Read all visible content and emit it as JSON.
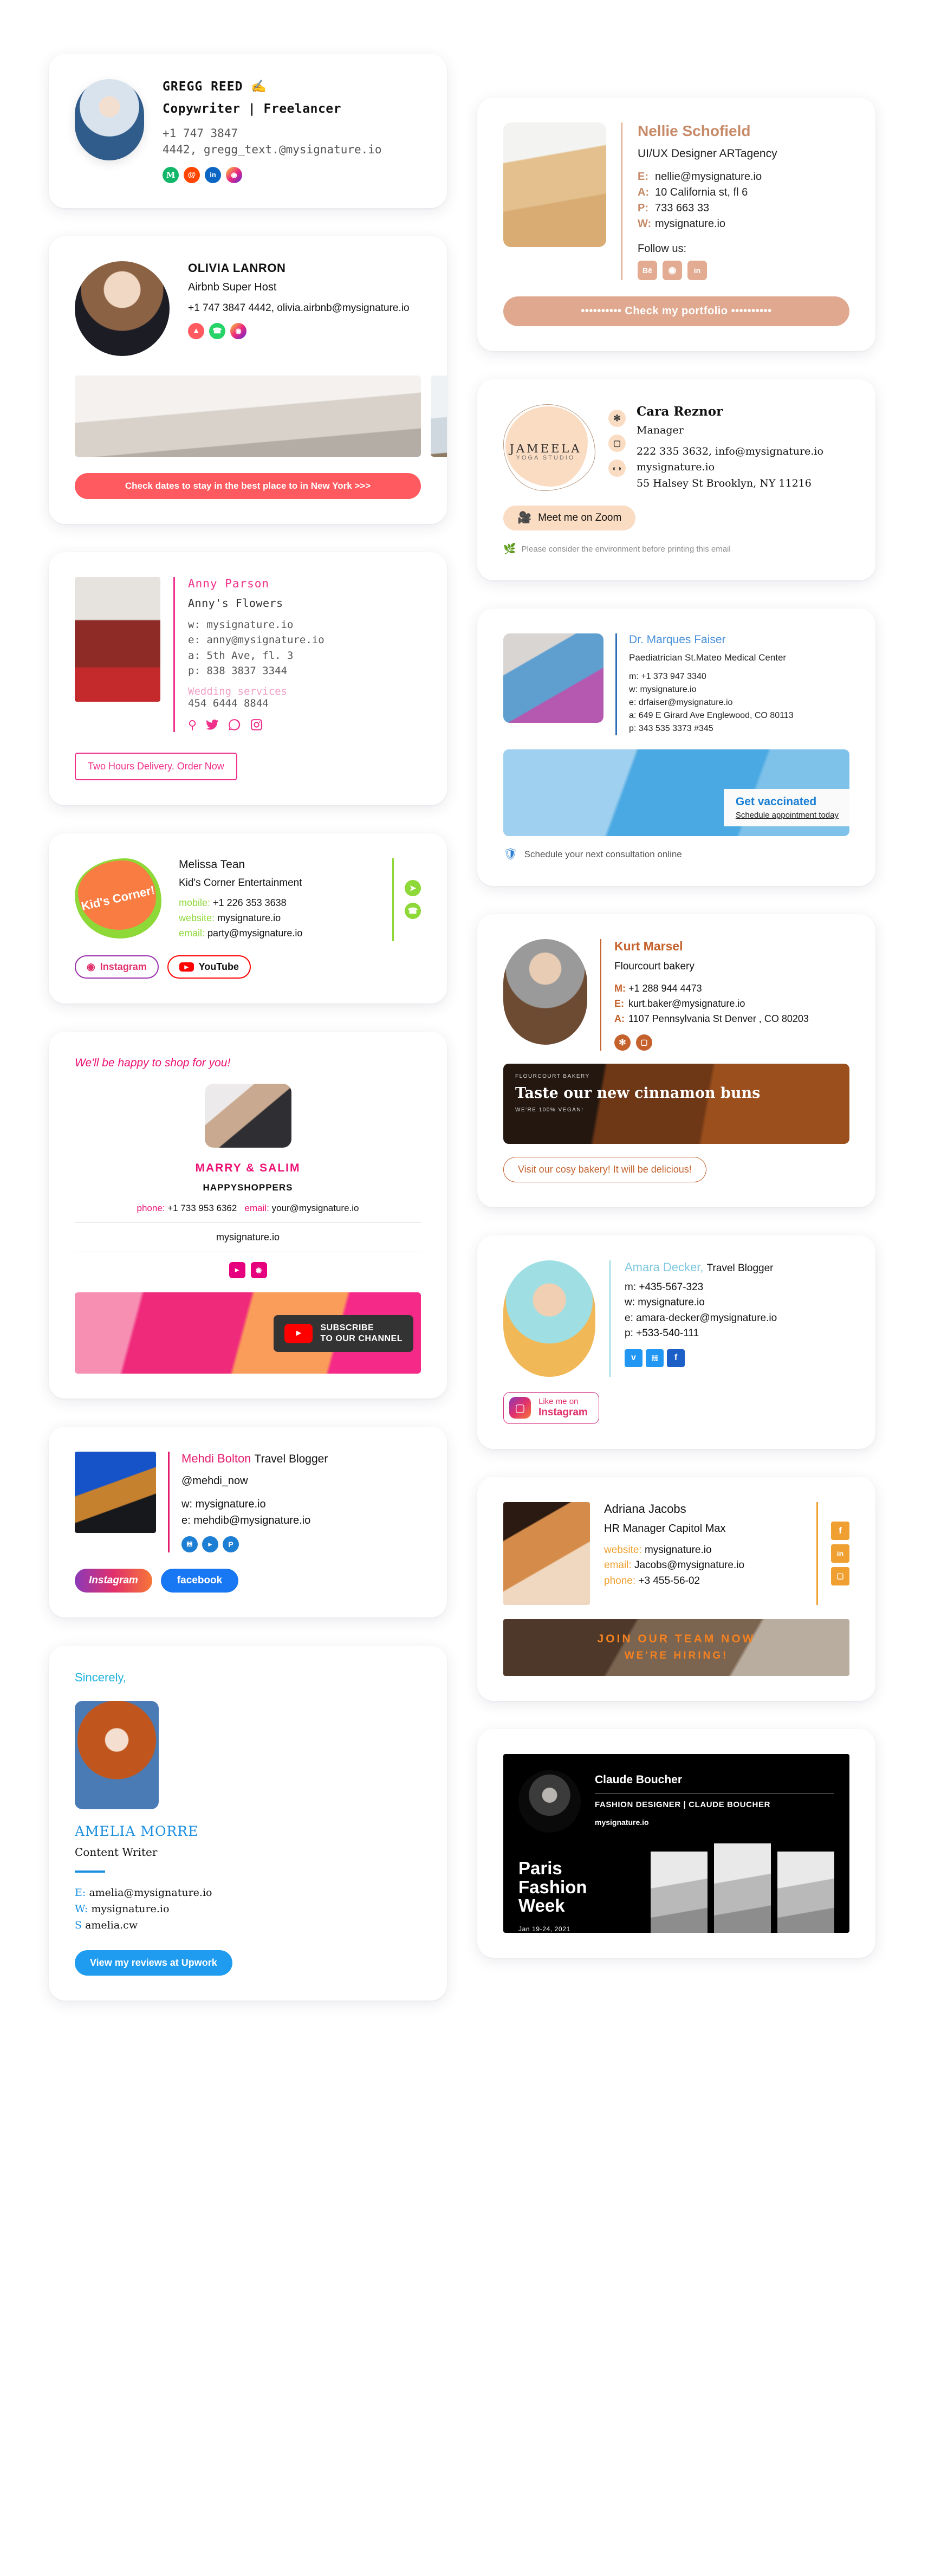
{
  "cards": {
    "gregg": {
      "name": "GREGG REED ✍️",
      "role": "Copywriter | Freelancer",
      "contact_line1": "+1 747 3847",
      "contact_line2": "4442, gregg_text.@mysignature.io",
      "socials": [
        "medium-icon",
        "reddit-icon",
        "linkedin-icon",
        "instagram-icon"
      ]
    },
    "nellie": {
      "name": "Nellie Schofield",
      "role": "UI/UX Designer ARTagency",
      "fields": [
        {
          "key": "E:",
          "value": "nellie@mysignature.io"
        },
        {
          "key": "A:",
          "value": "10 California st, fl 6"
        },
        {
          "key": "P:",
          "value": "733 663 33"
        },
        {
          "key": "W:",
          "value": "mysignature.io"
        }
      ],
      "follow_label": "Follow us:",
      "socials": [
        "behance-icon",
        "dribbble-icon",
        "linkedin-icon"
      ],
      "cta": "•••••••••• Check my portfolio ••••••••••",
      "accent": "#e0a98f"
    },
    "olivia": {
      "name": "OLIVIA LANRON",
      "role": "Airbnb Super Host",
      "contact": "+1 747 3847 4442, olivia.airbnb@mysignature.io",
      "socials": [
        "airbnb-icon",
        "whatsapp-icon",
        "instagram-icon"
      ],
      "cta": "Check dates to stay in the best place to in New York >>>",
      "accent": "#ff5a5f"
    },
    "cara": {
      "logo_name": "JAMEELA",
      "logo_sub": "YOGA STUDIO",
      "name": "Cara Reznor",
      "role": "Manager",
      "line1": "222 335 3632, info@mysignature.io",
      "line2": "mysignature.io",
      "line3": "55 Halsey St Brooklyn, NY 11216",
      "icons": [
        "yelp-icon",
        "instagram-icon",
        "tripadvisor-icon"
      ],
      "cta": "Meet me on Zoom",
      "eco_note": "Please consider the environment before printing this email",
      "accent": "#fadcc3"
    },
    "anny": {
      "name": "Anny Parson",
      "org": "Anny's Flowers",
      "details": [
        "w: mysignature.io",
        "e: anny@mysignature.io",
        "a: 5th Ave, fl. 3",
        "p: 838 3837 3344"
      ],
      "wedding_label": "Wedding services",
      "wedding_phone": "454 6444 8844",
      "socials": [
        "maps-icon",
        "twitter-icon",
        "whatsapp-icon",
        "instagram-icon"
      ],
      "cta": "Two Hours Delivery. Order Now",
      "accent": "#f0318b"
    },
    "doctor": {
      "name": "Dr. Marques Faiser",
      "role": "Paediatrician St.Mateo Medical Center",
      "details": [
        "m: +1 373 947 3340",
        "w: mysignature.io",
        "e: drfaiser@mysignature.io",
        "a: 649 E Girard Ave Englewood, CO 80113",
        "p: 343 535 3373 #345"
      ],
      "banner_title": "Get vaccinated",
      "banner_sub": "Schedule appointment today",
      "footer": "Schedule your next consultation online",
      "accent": "#4a90d9"
    },
    "kids": {
      "logo_text": "Kid's Corner!",
      "name": "Melissa Tean",
      "org": "Kid's Corner Entertainment",
      "fields": [
        {
          "key": "mobile:",
          "value": "+1 226 353 3638"
        },
        {
          "key": "website:",
          "value": "mysignature.io"
        },
        {
          "key": "email:",
          "value": "party@mysignature.io"
        }
      ],
      "side_socials": [
        "telegram-icon",
        "whatsapp-icon"
      ],
      "btn_instagram": "Instagram",
      "btn_youtube": "YouTube",
      "accent": "#8ed838"
    },
    "kurt": {
      "name": "Kurt Marsel",
      "role": "Flourcourt bakery",
      "fields": [
        {
          "key": "M:",
          "value": "+1 288 944 4473"
        },
        {
          "key": "E:",
          "value": "kurt.baker@mysignature.io"
        },
        {
          "key": "A:",
          "value": "1107 Pennsylvania St Denver , CO 80203"
        }
      ],
      "socials": [
        "yelp-icon",
        "instagram-icon"
      ],
      "banner_logo": "FLOURCOURT\nBAKERY",
      "banner_title": "Taste our new cinnamon buns",
      "banner_sub": "WE'RE 100% VEGAN!",
      "cta": "Visit our cosy bakery! It will be delicious!",
      "accent": "#c4612c"
    },
    "shoppers": {
      "tagline": "We'll be happy to shop for you!",
      "name": "MARRY & SALIM",
      "org": "HAPPYSHOPPERS",
      "phone_label": "phone:",
      "phone": "+1 733 953 6362",
      "email_label": "email:",
      "email": "your@mysignature.io",
      "website": "mysignature.io",
      "socials": [
        "youtube-icon",
        "instagram-icon"
      ],
      "banner_line1": "SUBSCRIBE",
      "banner_line2": "TO OUR CHANNEL",
      "accent": "#ec1073"
    },
    "amara": {
      "name": "Amara Decker,",
      "job": "Travel Blogger",
      "details": [
        "m: +435-567-323",
        "w: mysignature.io",
        "e: amara-decker@mysignature.io",
        "p: +533-540-111"
      ],
      "socials": [
        "vimeo-icon",
        "twitter-icon",
        "facebook-icon"
      ],
      "cta_small": "Like me on",
      "cta_big": "Instagram",
      "accent": "#7fc8e0"
    },
    "mehdi": {
      "name": "Mehdi Bolton",
      "job": "Travel Blogger",
      "handle": "@mehdi_now",
      "details": [
        "w: mysignature.io",
        "e: mehdib@mysignature.io"
      ],
      "socials": [
        "twitter-icon",
        "youtube-icon",
        "pinterest-icon"
      ],
      "btn_instagram": "Instagram",
      "btn_facebook": "facebook",
      "accent": "#e31b6d"
    },
    "adriana": {
      "name": "Adriana Jacobs",
      "role": "HR Manager Capitol Max",
      "fields": [
        {
          "key": "website:",
          "value": "mysignature.io"
        },
        {
          "key": "email:",
          "value": "Jacobs@mysignature.io"
        },
        {
          "key": "phone:",
          "value": "+3 455-56-02"
        }
      ],
      "socials": [
        "facebook-icon",
        "linkedin-icon",
        "instagram-icon"
      ],
      "banner_line1": "JOIN OUR TEAM NOW",
      "banner_line2": "WE'RE HIRING!",
      "accent": "#f0a030"
    },
    "amelia": {
      "sincerely": "Sincerely,",
      "name": "AMELIA MORRE",
      "role": "Content Writer",
      "fields": [
        {
          "key": "E:",
          "value": "amelia@mysignature.io"
        },
        {
          "key": "W:",
          "value": "mysignature.io"
        },
        {
          "key": "S",
          "value": "amelia.cw"
        }
      ],
      "cta": "View my reviews at Upwork",
      "accent": "#1a8fe0"
    },
    "claude": {
      "name": "Claude Boucher",
      "role": "FASHION DESIGNER | CLAUDE BOUCHER",
      "website": "mysignature.io",
      "event_title": "Paris\nFashion\nWeek",
      "event_date": "Jan 19-24, 2021",
      "accent": "#000000"
    }
  }
}
